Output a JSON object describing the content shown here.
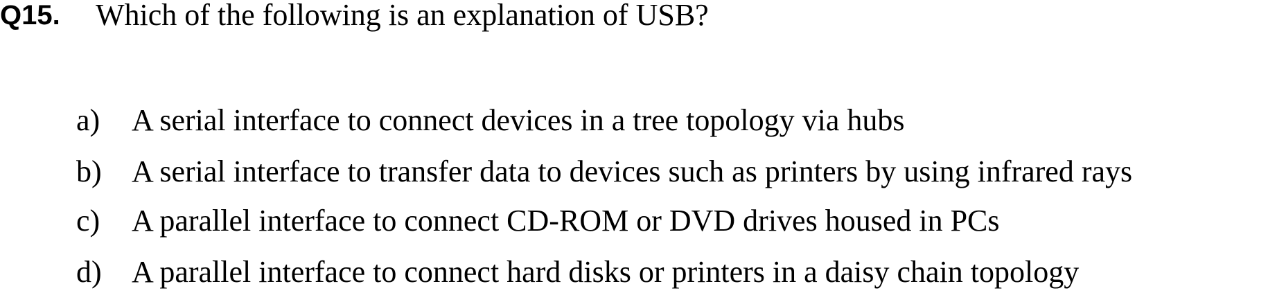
{
  "question": {
    "number": "Q15.",
    "text": "Which of the following is an explanation of USB?"
  },
  "options": [
    {
      "letter": "a)",
      "text": "A serial interface to connect devices in a tree topology via hubs"
    },
    {
      "letter": "b)",
      "text": "A serial interface to transfer data to devices such as printers by using infrared rays"
    },
    {
      "letter": "c)",
      "text": "A parallel interface to connect CD-ROM or DVD drives housed in PCs"
    },
    {
      "letter": "d)",
      "text": "A parallel interface to connect hard disks or printers in a daisy chain topology"
    }
  ]
}
